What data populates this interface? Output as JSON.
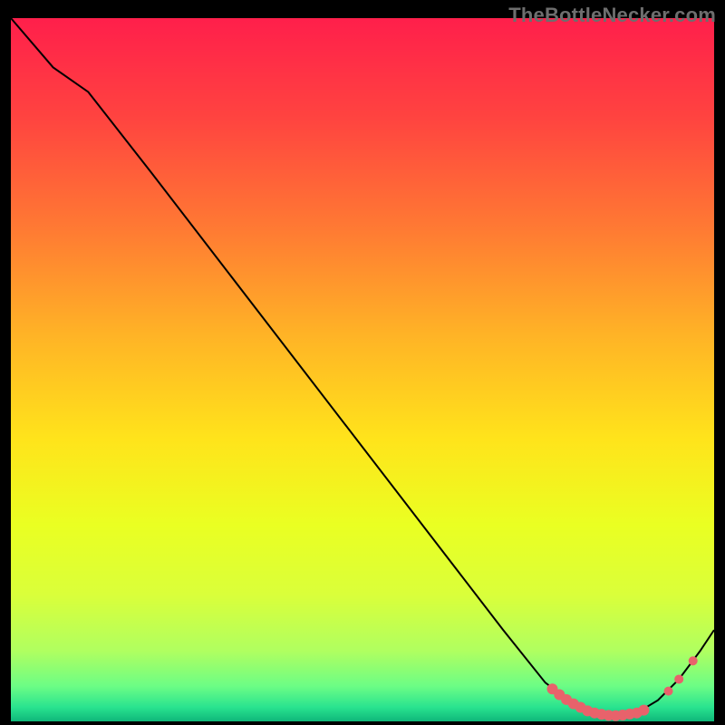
{
  "watermark": "TheBottleNecker.com",
  "chart_data": {
    "type": "line",
    "title": "",
    "xlabel": "",
    "ylabel": "",
    "xlim": [
      0,
      100
    ],
    "ylim": [
      0,
      100
    ],
    "gradient_stops": [
      {
        "offset": 0.0,
        "color": "#ff1f4b"
      },
      {
        "offset": 0.14,
        "color": "#ff4340"
      },
      {
        "offset": 0.3,
        "color": "#ff7a33"
      },
      {
        "offset": 0.45,
        "color": "#ffb326"
      },
      {
        "offset": 0.6,
        "color": "#ffe41b"
      },
      {
        "offset": 0.72,
        "color": "#eaff22"
      },
      {
        "offset": 0.82,
        "color": "#daff3a"
      },
      {
        "offset": 0.9,
        "color": "#b0ff60"
      },
      {
        "offset": 0.95,
        "color": "#6cfd85"
      },
      {
        "offset": 0.98,
        "color": "#29e38f"
      },
      {
        "offset": 1.0,
        "color": "#0fb77a"
      }
    ],
    "curve": [
      {
        "x": 0,
        "y": 100
      },
      {
        "x": 6,
        "y": 93
      },
      {
        "x": 11,
        "y": 89.5
      },
      {
        "x": 20,
        "y": 78
      },
      {
        "x": 30,
        "y": 65
      },
      {
        "x": 40,
        "y": 52
      },
      {
        "x": 50,
        "y": 39
      },
      {
        "x": 60,
        "y": 26
      },
      {
        "x": 70,
        "y": 13
      },
      {
        "x": 76,
        "y": 5.5
      },
      {
        "x": 80,
        "y": 2.5
      },
      {
        "x": 83,
        "y": 1.2
      },
      {
        "x": 86,
        "y": 0.8
      },
      {
        "x": 89,
        "y": 1.2
      },
      {
        "x": 92,
        "y": 3
      },
      {
        "x": 95,
        "y": 6
      },
      {
        "x": 98,
        "y": 10
      },
      {
        "x": 100,
        "y": 13
      }
    ],
    "marker_points": [
      {
        "x": 77,
        "y": 4.6
      },
      {
        "x": 78,
        "y": 3.8
      },
      {
        "x": 79,
        "y": 3.1
      },
      {
        "x": 80,
        "y": 2.5
      },
      {
        "x": 81,
        "y": 2.0
      },
      {
        "x": 82,
        "y": 1.5
      },
      {
        "x": 83,
        "y": 1.2
      },
      {
        "x": 84,
        "y": 1.0
      },
      {
        "x": 85,
        "y": 0.85
      },
      {
        "x": 86,
        "y": 0.8
      },
      {
        "x": 87,
        "y": 0.9
      },
      {
        "x": 88,
        "y": 1.05
      },
      {
        "x": 89,
        "y": 1.2
      },
      {
        "x": 90,
        "y": 1.6
      },
      {
        "x": 93.5,
        "y": 4.3
      },
      {
        "x": 95,
        "y": 6.0
      },
      {
        "x": 97,
        "y": 8.6
      }
    ],
    "marker_color": "#e8626b",
    "marker_radius_main": 6,
    "marker_radius_tail": 5,
    "curve_color": "#000000",
    "curve_width": 2
  }
}
